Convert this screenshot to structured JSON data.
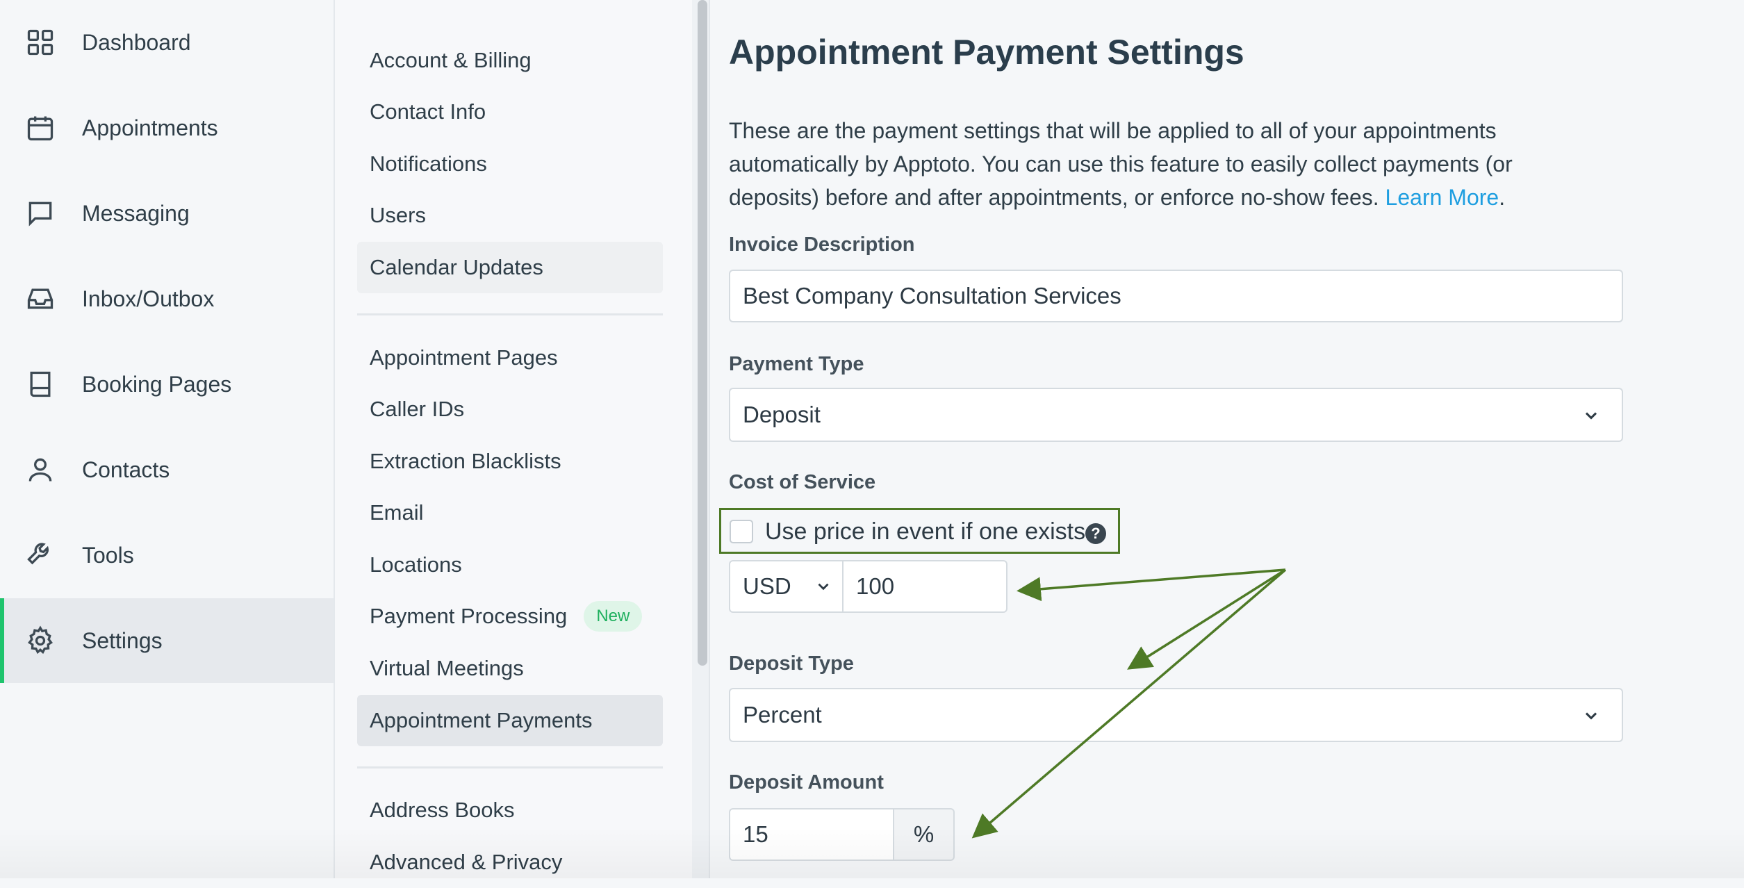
{
  "nav": {
    "items": [
      {
        "label": "Dashboard",
        "icon": "dashboard-icon"
      },
      {
        "label": "Appointments",
        "icon": "calendar-icon"
      },
      {
        "label": "Messaging",
        "icon": "message-icon"
      },
      {
        "label": "Inbox/Outbox",
        "icon": "inbox-icon"
      },
      {
        "label": "Booking Pages",
        "icon": "book-icon"
      },
      {
        "label": "Contacts",
        "icon": "user-icon"
      },
      {
        "label": "Tools",
        "icon": "wrench-icon"
      },
      {
        "label": "Settings",
        "icon": "gear-icon",
        "active": true
      }
    ]
  },
  "subnav": {
    "group1": [
      "Account & Billing",
      "Contact Info",
      "Notifications",
      "Users",
      "Calendar Updates"
    ],
    "group2": [
      "Appointment Pages",
      "Caller IDs",
      "Extraction Blacklists",
      "Email",
      "Locations",
      "Payment Processing",
      "Virtual Meetings",
      "Appointment Payments"
    ],
    "payment_processing_badge": "New",
    "group3": [
      "Address Books",
      "Advanced & Privacy"
    ]
  },
  "main": {
    "title": "Appointment Payment Settings",
    "intro_text": "These are the payment settings that will be applied to all of your appointments automatically by Apptoto. You can use this feature to easily collect payments (or deposits) before and after appointments, or enforce no-show fees.",
    "learn_more": "Learn More",
    "intro_end": ".",
    "invoice_description": {
      "label": "Invoice Description",
      "value": "Best Company Consultation Services"
    },
    "payment_type": {
      "label": "Payment Type",
      "value": "Deposit"
    },
    "cost_of_service": {
      "label": "Cost of Service",
      "checkbox_label": "Use price in event if one exists.",
      "checked": false,
      "help_icon": "question-circle-icon",
      "currency": "USD",
      "amount": "100"
    },
    "deposit_type": {
      "label": "Deposit Type",
      "value": "Percent"
    },
    "deposit_amount": {
      "label": "Deposit Amount",
      "value": "15",
      "suffix": "%"
    }
  },
  "colors": {
    "accent_green": "#1fc46d",
    "annotation_green": "#4e7a26",
    "link_blue": "#1e9ee0"
  }
}
